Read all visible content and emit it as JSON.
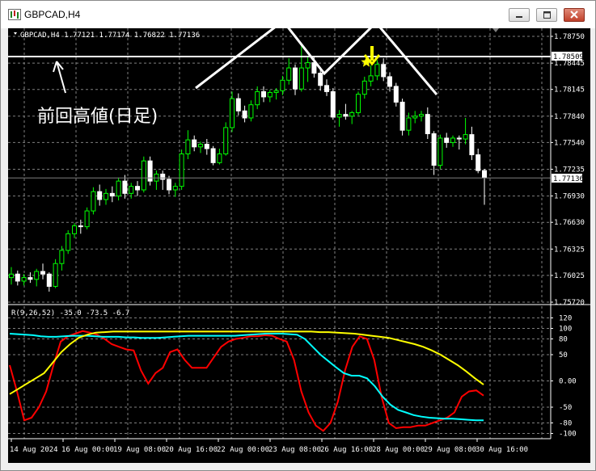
{
  "window": {
    "title": "GBPCAD,H4"
  },
  "chart_header": {
    "symbol_text": "GBPCAD,H4  1.77121 1.77174 1.76822 1.77136"
  },
  "indicator_header": {
    "text": "R(9,26,52) -35.0 -73.5 -6.7"
  },
  "annotation": {
    "text": "前回高値(日足)"
  },
  "colors": {
    "background": "#000000",
    "grid": "#7f7f7f",
    "bull_candle": "#00ff00",
    "bear_candle": "#ffffff",
    "fast_line": "#ff0000",
    "mid_line": "#00ffff",
    "slow_line": "#ffff00",
    "star": "#ffff00",
    "drawing": "#ffffff"
  },
  "chart_data": [
    {
      "type": "candlestick",
      "price_axis_ticks": [
        "1.78750",
        "1.78445",
        "1.78145",
        "1.77840",
        "1.77540",
        "1.77235",
        "1.76930",
        "1.76630",
        "1.76325",
        "1.76025",
        "1.75720"
      ],
      "ylim": [
        1.7572,
        1.7875
      ],
      "resistance_level": 1.78509,
      "resistance_label": "1.78509",
      "current_price": 1.77136,
      "current_price_label": "1.77136",
      "time_axis_labels": [
        "14 Aug 2024",
        "16 Aug 00:00",
        "19 Aug 08:00",
        "20 Aug 16:00",
        "22 Aug 00:00",
        "23 Aug 08:00",
        "26 Aug 16:00",
        "28 Aug 00:00",
        "29 Aug 08:00",
        "30 Aug 16:00"
      ],
      "candles": [
        [
          1.76,
          1.7612,
          1.7592,
          1.7604
        ],
        [
          1.7604,
          1.7608,
          1.7591,
          1.7596
        ],
        [
          1.7596,
          1.7604,
          1.7591,
          1.76
        ],
        [
          1.76,
          1.7606,
          1.7594,
          1.7598
        ],
        [
          1.7598,
          1.761,
          1.759,
          1.7607
        ],
        [
          1.7607,
          1.7616,
          1.7598,
          1.7604
        ],
        [
          1.7604,
          1.7606,
          1.7584,
          1.759
        ],
        [
          1.759,
          1.7621,
          1.7588,
          1.7616
        ],
        [
          1.7616,
          1.7636,
          1.7608,
          1.7631
        ],
        [
          1.7631,
          1.7654,
          1.7627,
          1.765
        ],
        [
          1.765,
          1.7662,
          1.7645,
          1.7659
        ],
        [
          1.7659,
          1.7666,
          1.765,
          1.7658
        ],
        [
          1.7658,
          1.768,
          1.7655,
          1.7676
        ],
        [
          1.7676,
          1.7703,
          1.7672,
          1.7698
        ],
        [
          1.7698,
          1.7706,
          1.7682,
          1.7689
        ],
        [
          1.7689,
          1.7701,
          1.7683,
          1.7696
        ],
        [
          1.7696,
          1.7704,
          1.7686,
          1.7693
        ],
        [
          1.7693,
          1.7714,
          1.7688,
          1.771
        ],
        [
          1.771,
          1.7717,
          1.769,
          1.7696
        ],
        [
          1.7696,
          1.7708,
          1.769,
          1.7704
        ],
        [
          1.7704,
          1.771,
          1.7693,
          1.77
        ],
        [
          1.77,
          1.7738,
          1.7697,
          1.7733
        ],
        [
          1.7733,
          1.7738,
          1.7705,
          1.771
        ],
        [
          1.771,
          1.7722,
          1.77,
          1.7718
        ],
        [
          1.7718,
          1.7722,
          1.77,
          1.7712
        ],
        [
          1.7712,
          1.7716,
          1.7695,
          1.77
        ],
        [
          1.77,
          1.7708,
          1.7692,
          1.7704
        ],
        [
          1.7704,
          1.7746,
          1.77,
          1.7741
        ],
        [
          1.7741,
          1.7768,
          1.7735,
          1.7757
        ],
        [
          1.7757,
          1.7762,
          1.7744,
          1.7749
        ],
        [
          1.7749,
          1.7755,
          1.7742,
          1.7752
        ],
        [
          1.7752,
          1.7758,
          1.774,
          1.7747
        ],
        [
          1.7747,
          1.775,
          1.7728,
          1.7731
        ],
        [
          1.7731,
          1.7747,
          1.7729,
          1.7741
        ],
        [
          1.7741,
          1.7777,
          1.7739,
          1.7771
        ],
        [
          1.7771,
          1.7812,
          1.7766,
          1.7804
        ],
        [
          1.7804,
          1.781,
          1.7785,
          1.779
        ],
        [
          1.779,
          1.7796,
          1.7777,
          1.7782
        ],
        [
          1.7782,
          1.7802,
          1.7778,
          1.7797
        ],
        [
          1.7797,
          1.7818,
          1.7792,
          1.7812
        ],
        [
          1.7812,
          1.7818,
          1.78,
          1.7806
        ],
        [
          1.7806,
          1.7814,
          1.78,
          1.7811
        ],
        [
          1.7811,
          1.7816,
          1.7803,
          1.7813
        ],
        [
          1.7813,
          1.783,
          1.7808,
          1.7825
        ],
        [
          1.7825,
          1.785,
          1.782,
          1.7839
        ],
        [
          1.7839,
          1.7843,
          1.7808,
          1.7815
        ],
        [
          1.7815,
          1.7865,
          1.7812,
          1.7839
        ],
        [
          1.7839,
          1.7852,
          1.7823,
          1.7845
        ],
        [
          1.7845,
          1.7851,
          1.7828,
          1.7833
        ],
        [
          1.7833,
          1.784,
          1.7813,
          1.7819
        ],
        [
          1.7819,
          1.7826,
          1.7807,
          1.7812
        ],
        [
          1.7812,
          1.7816,
          1.778,
          1.7783
        ],
        [
          1.7783,
          1.7791,
          1.7772,
          1.7786
        ],
        [
          1.7786,
          1.7798,
          1.778,
          1.7784
        ],
        [
          1.7784,
          1.779,
          1.7775,
          1.7788
        ],
        [
          1.7788,
          1.7812,
          1.7785,
          1.7809
        ],
        [
          1.7809,
          1.7829,
          1.7804,
          1.7824
        ],
        [
          1.7824,
          1.7842,
          1.7818,
          1.783
        ],
        [
          1.783,
          1.7848,
          1.7825,
          1.7843
        ],
        [
          1.7843,
          1.785,
          1.7824,
          1.7829
        ],
        [
          1.7829,
          1.7834,
          1.7812,
          1.7818
        ],
        [
          1.7818,
          1.7822,
          1.7795,
          1.78
        ],
        [
          1.78,
          1.7804,
          1.7762,
          1.7768
        ],
        [
          1.7768,
          1.7788,
          1.7762,
          1.7782
        ],
        [
          1.7782,
          1.779,
          1.7776,
          1.7784
        ],
        [
          1.7784,
          1.779,
          1.7778,
          1.7786
        ],
        [
          1.7786,
          1.7794,
          1.7758,
          1.7764
        ],
        [
          1.7764,
          1.7767,
          1.7717,
          1.7728
        ],
        [
          1.7728,
          1.7763,
          1.7724,
          1.7759
        ],
        [
          1.7759,
          1.7765,
          1.7748,
          1.7754
        ],
        [
          1.7754,
          1.7762,
          1.7749,
          1.7759
        ],
        [
          1.7759,
          1.7762,
          1.7746,
          1.7758
        ],
        [
          1.7758,
          1.7782,
          1.7752,
          1.7763
        ],
        [
          1.7763,
          1.7772,
          1.7734,
          1.774
        ],
        [
          1.774,
          1.7747,
          1.7719,
          1.7722
        ],
        [
          1.7722,
          1.7724,
          1.7683,
          1.7714
        ]
      ]
    },
    {
      "type": "line",
      "ylim": [
        -110,
        130
      ],
      "y_ticks": [
        "120",
        "100",
        "80",
        "50",
        "0.00",
        "-50",
        "-80",
        "-100"
      ],
      "series": [
        {
          "color": "#ff0000",
          "values": [
            30,
            -20,
            -75,
            -70,
            -50,
            -20,
            30,
            75,
            85,
            90,
            95,
            92,
            88,
            80,
            70,
            65,
            60,
            58,
            20,
            -5,
            15,
            25,
            55,
            60,
            40,
            25,
            25,
            25,
            45,
            65,
            75,
            80,
            82,
            85,
            85,
            87,
            86,
            80,
            75,
            40,
            -20,
            -60,
            -85,
            -95,
            -80,
            -40,
            20,
            65,
            85,
            80,
            40,
            -30,
            -80,
            -90,
            -88,
            -88,
            -85,
            -85,
            -80,
            -75,
            -70,
            -60,
            -30,
            -20,
            -18,
            -28
          ]
        },
        {
          "color": "#00ffff",
          "values": [
            90,
            89,
            88,
            87,
            85,
            84,
            84,
            85,
            86,
            86,
            86,
            85,
            84,
            84,
            84,
            83,
            83,
            82,
            82,
            82,
            83,
            84,
            85,
            86,
            86,
            86,
            86,
            86,
            86,
            86,
            87,
            88,
            89,
            90,
            90,
            90,
            89,
            88,
            80,
            65,
            50,
            38,
            26,
            15,
            10,
            10,
            5,
            -10,
            -30,
            -45,
            -55,
            -60,
            -65,
            -68,
            -70,
            -71,
            -72,
            -72,
            -73,
            -74,
            -75,
            -75
          ]
        },
        {
          "color": "#ffff00",
          "values": [
            -25,
            -15,
            -5,
            5,
            15,
            35,
            55,
            70,
            82,
            88,
            92,
            93,
            94,
            94,
            94,
            94,
            94,
            94,
            94,
            94,
            94,
            94,
            94,
            94,
            94,
            94,
            94,
            94,
            94,
            94,
            94,
            94,
            94,
            94,
            94,
            94,
            93,
            93,
            92,
            91,
            90,
            88,
            86,
            84,
            82,
            78,
            74,
            70,
            65,
            58,
            50,
            40,
            30,
            18,
            5,
            -7
          ]
        }
      ]
    }
  ]
}
